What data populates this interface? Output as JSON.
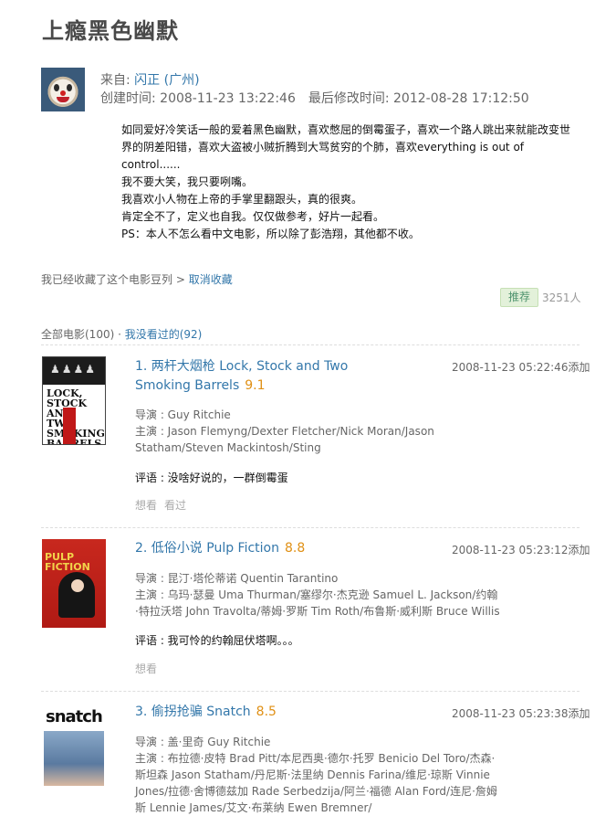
{
  "page": {
    "title": "上瘾黑色幽默"
  },
  "doulist": {
    "from_label": "来自: ",
    "author": "闪正",
    "location": "(广州)",
    "created": "创建时间: 2008-11-23 13:22:46",
    "modified": "最后修改时间: 2012-08-28 17:12:50",
    "description": [
      "如同爱好冷笑话一般的爱着黑色幽默，喜欢憋屈的倒霉蛋子，喜欢一个路人跳出来就能改变世界的阴差阳错，喜欢大盗被小贼折腾到大骂贫穷的个肺，喜欢everything is out of control......",
      "我不要大笑，我只要咧嘴。",
      "我喜欢小人物在上帝的手掌里翻跟头，真的很爽。",
      "肯定全不了，定义也自我。仅仅做参考，好片一起看。",
      "PS：本人不怎么看中文电影，所以除了彭浩翔，其他都不收。"
    ],
    "collected_text": "我已经收藏了这个电影豆列 > ",
    "cancel_collect": "取消收藏",
    "recommend_button": "推荐",
    "recommend_count": "3251人"
  },
  "filter": {
    "all": "全部电影(100)",
    "separator": " · ",
    "unseen": "我没看过的(92)"
  },
  "items": [
    {
      "title": "1. 两杆大烟枪 Lock, Stock and Two Smoking Barrels",
      "rating": "9.1",
      "added": "2008-11-23 05:22:46添加",
      "director": "导演 : Guy Ritchie",
      "cast": "主演 : Jason Flemyng/Dexter Fletcher/Nick Moran/Jason Statham/Steven Mackintosh/Sting",
      "comment": "评语 : 没啥好说的，一群倒霉蛋",
      "actions": [
        "想看",
        "看过"
      ],
      "poster_text": "LOCK, STOCK AND TWO SMOKING BARRELS"
    },
    {
      "title": "2. 低俗小说 Pulp Fiction",
      "rating": "8.8",
      "added": "2008-11-23 05:23:12添加",
      "director": "导演 : 昆汀·塔伦蒂诺 Quentin Tarantino",
      "cast": "主演 : 乌玛·瑟曼 Uma Thurman/塞缪尔·杰克逊 Samuel L. Jackson/约翰·特拉沃塔 John Travolta/蒂姆·罗斯 Tim Roth/布鲁斯·威利斯 Bruce Willis",
      "comment": "评语 : 我可怜的约翰屈伏塔啊。。。",
      "actions": [
        "想看"
      ],
      "poster_text": "PULP FICTION"
    },
    {
      "title": "3. 偷拐抢骗 Snatch",
      "rating": "8.5",
      "added": "2008-11-23 05:23:38添加",
      "director": "导演 : 盖·里奇 Guy Ritchie",
      "cast": "主演 : 布拉德·皮特 Brad Pitt/本尼西奥·德尔·托罗 Benicio Del Toro/杰森·斯坦森 Jason Statham/丹尼斯·法里纳 Dennis Farina/维尼·琼斯 Vinnie Jones/拉德·舍博德兹加 Rade Serbedzija/阿兰·福德 Alan Ford/连尼·詹姆斯 Lennie James/艾文·布莱纳 Ewen Bremner/",
      "poster_text": "snatch"
    }
  ]
}
